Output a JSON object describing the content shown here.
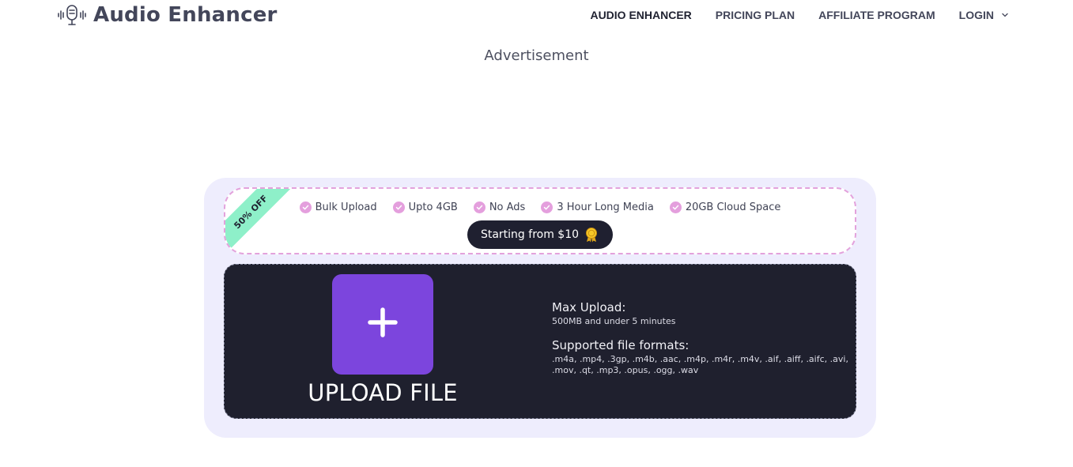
{
  "header": {
    "logo_text": "Audio Enhancer",
    "logo_icon": "microphone-wave-icon",
    "nav": [
      {
        "label": "AUDIO ENHANCER"
      },
      {
        "label": "PRICING PLAN"
      },
      {
        "label": "AFFILIATE PROGRAM"
      },
      {
        "label": "LOGIN"
      }
    ]
  },
  "ad_label": "Advertisement",
  "promo": {
    "ribbon": "50% OFF",
    "features": [
      {
        "label": "Bulk Upload"
      },
      {
        "label": "Upto 4GB"
      },
      {
        "label": "No Ads"
      },
      {
        "label": "3 Hour Long Media"
      },
      {
        "label": "20GB Cloud Space"
      }
    ],
    "price_button": "Starting from $10",
    "price_icon": "medal-icon"
  },
  "upload": {
    "label": "UPLOAD FILE",
    "max_title": "Max Upload:",
    "max_text": "500MB and under 5 minutes",
    "formats_title": "Supported file formats:",
    "formats_text": ".m4a, .mp4, .3gp, .m4b, .aac, .m4p, .m4r, .m4v, .aif, .aiff, .aifc, .avi, .mov, .qt, .mp3, .opus, .ogg, .wav"
  },
  "colors": {
    "accent": "#7c45dd",
    "dark": "#1f202e",
    "card_bg": "#eeedfd",
    "ribbon": "#8ef0c9",
    "check": "#e49fdd"
  }
}
